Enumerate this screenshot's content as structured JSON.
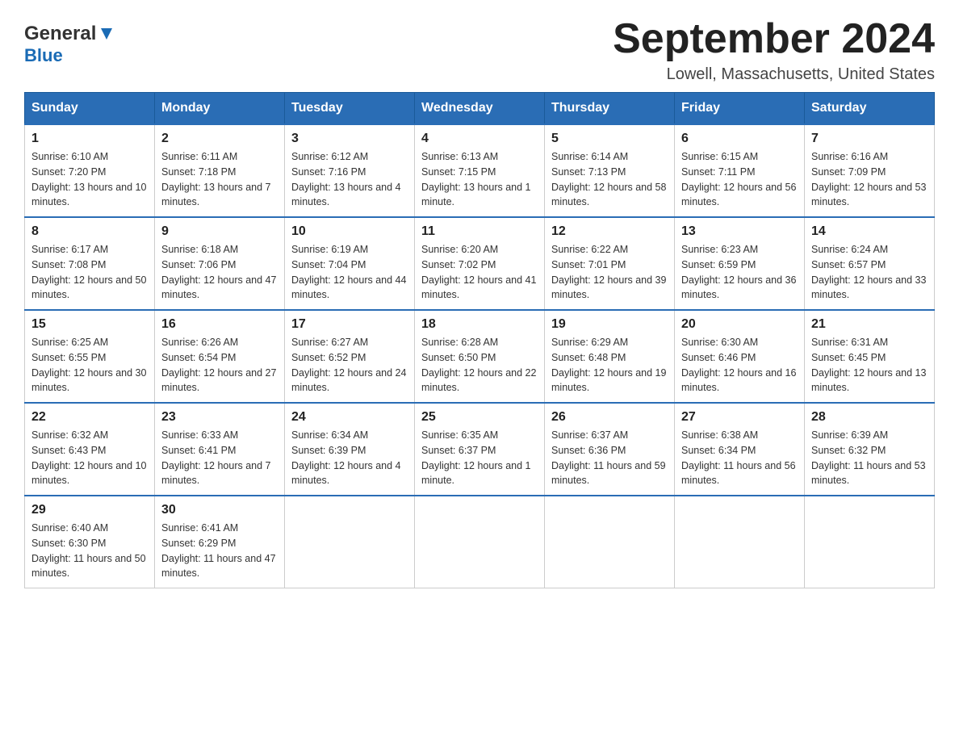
{
  "header": {
    "logo_general": "General",
    "logo_blue": "Blue",
    "title": "September 2024",
    "subtitle": "Lowell, Massachusetts, United States"
  },
  "days_of_week": [
    "Sunday",
    "Monday",
    "Tuesday",
    "Wednesday",
    "Thursday",
    "Friday",
    "Saturday"
  ],
  "weeks": [
    [
      {
        "day": "1",
        "sunrise": "6:10 AM",
        "sunset": "7:20 PM",
        "daylight": "13 hours and 10 minutes."
      },
      {
        "day": "2",
        "sunrise": "6:11 AM",
        "sunset": "7:18 PM",
        "daylight": "13 hours and 7 minutes."
      },
      {
        "day": "3",
        "sunrise": "6:12 AM",
        "sunset": "7:16 PM",
        "daylight": "13 hours and 4 minutes."
      },
      {
        "day": "4",
        "sunrise": "6:13 AM",
        "sunset": "7:15 PM",
        "daylight": "13 hours and 1 minute."
      },
      {
        "day": "5",
        "sunrise": "6:14 AM",
        "sunset": "7:13 PM",
        "daylight": "12 hours and 58 minutes."
      },
      {
        "day": "6",
        "sunrise": "6:15 AM",
        "sunset": "7:11 PM",
        "daylight": "12 hours and 56 minutes."
      },
      {
        "day": "7",
        "sunrise": "6:16 AM",
        "sunset": "7:09 PM",
        "daylight": "12 hours and 53 minutes."
      }
    ],
    [
      {
        "day": "8",
        "sunrise": "6:17 AM",
        "sunset": "7:08 PM",
        "daylight": "12 hours and 50 minutes."
      },
      {
        "day": "9",
        "sunrise": "6:18 AM",
        "sunset": "7:06 PM",
        "daylight": "12 hours and 47 minutes."
      },
      {
        "day": "10",
        "sunrise": "6:19 AM",
        "sunset": "7:04 PM",
        "daylight": "12 hours and 44 minutes."
      },
      {
        "day": "11",
        "sunrise": "6:20 AM",
        "sunset": "7:02 PM",
        "daylight": "12 hours and 41 minutes."
      },
      {
        "day": "12",
        "sunrise": "6:22 AM",
        "sunset": "7:01 PM",
        "daylight": "12 hours and 39 minutes."
      },
      {
        "day": "13",
        "sunrise": "6:23 AM",
        "sunset": "6:59 PM",
        "daylight": "12 hours and 36 minutes."
      },
      {
        "day": "14",
        "sunrise": "6:24 AM",
        "sunset": "6:57 PM",
        "daylight": "12 hours and 33 minutes."
      }
    ],
    [
      {
        "day": "15",
        "sunrise": "6:25 AM",
        "sunset": "6:55 PM",
        "daylight": "12 hours and 30 minutes."
      },
      {
        "day": "16",
        "sunrise": "6:26 AM",
        "sunset": "6:54 PM",
        "daylight": "12 hours and 27 minutes."
      },
      {
        "day": "17",
        "sunrise": "6:27 AM",
        "sunset": "6:52 PM",
        "daylight": "12 hours and 24 minutes."
      },
      {
        "day": "18",
        "sunrise": "6:28 AM",
        "sunset": "6:50 PM",
        "daylight": "12 hours and 22 minutes."
      },
      {
        "day": "19",
        "sunrise": "6:29 AM",
        "sunset": "6:48 PM",
        "daylight": "12 hours and 19 minutes."
      },
      {
        "day": "20",
        "sunrise": "6:30 AM",
        "sunset": "6:46 PM",
        "daylight": "12 hours and 16 minutes."
      },
      {
        "day": "21",
        "sunrise": "6:31 AM",
        "sunset": "6:45 PM",
        "daylight": "12 hours and 13 minutes."
      }
    ],
    [
      {
        "day": "22",
        "sunrise": "6:32 AM",
        "sunset": "6:43 PM",
        "daylight": "12 hours and 10 minutes."
      },
      {
        "day": "23",
        "sunrise": "6:33 AM",
        "sunset": "6:41 PM",
        "daylight": "12 hours and 7 minutes."
      },
      {
        "day": "24",
        "sunrise": "6:34 AM",
        "sunset": "6:39 PM",
        "daylight": "12 hours and 4 minutes."
      },
      {
        "day": "25",
        "sunrise": "6:35 AM",
        "sunset": "6:37 PM",
        "daylight": "12 hours and 1 minute."
      },
      {
        "day": "26",
        "sunrise": "6:37 AM",
        "sunset": "6:36 PM",
        "daylight": "11 hours and 59 minutes."
      },
      {
        "day": "27",
        "sunrise": "6:38 AM",
        "sunset": "6:34 PM",
        "daylight": "11 hours and 56 minutes."
      },
      {
        "day": "28",
        "sunrise": "6:39 AM",
        "sunset": "6:32 PM",
        "daylight": "11 hours and 53 minutes."
      }
    ],
    [
      {
        "day": "29",
        "sunrise": "6:40 AM",
        "sunset": "6:30 PM",
        "daylight": "11 hours and 50 minutes."
      },
      {
        "day": "30",
        "sunrise": "6:41 AM",
        "sunset": "6:29 PM",
        "daylight": "11 hours and 47 minutes."
      },
      null,
      null,
      null,
      null,
      null
    ]
  ],
  "labels": {
    "sunrise_prefix": "Sunrise: ",
    "sunset_prefix": "Sunset: ",
    "daylight_prefix": "Daylight: "
  }
}
